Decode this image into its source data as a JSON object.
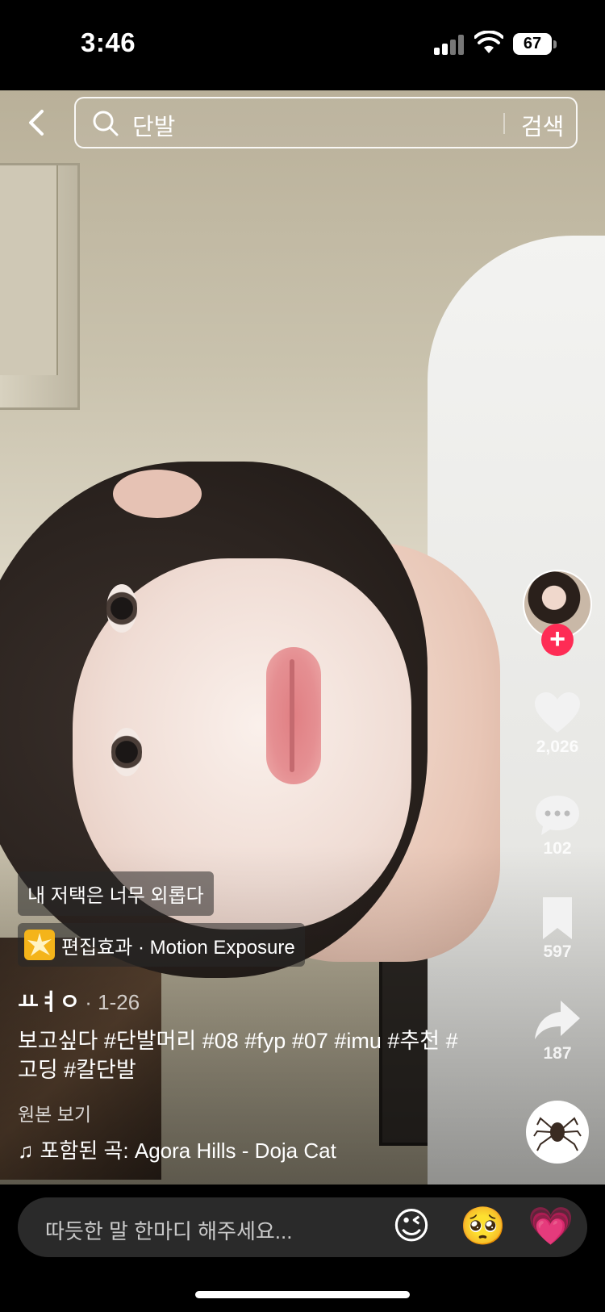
{
  "status_bar": {
    "time": "3:46",
    "battery": "67"
  },
  "search": {
    "query": "단발",
    "button_label": "검색"
  },
  "actions": {
    "likes": "2,026",
    "comments": "102",
    "saves": "597",
    "shares": "187"
  },
  "overlay": {
    "sticker_tag": "내 저택은 너무 외롭다",
    "effect_tag": "편집효과 · Motion Exposure",
    "author": "ㅛㅕㅇ",
    "date": "· 1-26",
    "description": "보고싶다 #단발머리 #08 #fyp #07 #imu #추천 #고딩 #칼단발",
    "original_link": "원본 보기",
    "song": "포함된 곡: Agora Hills - Doja Cat"
  },
  "comment_bar": {
    "placeholder": "따듯한 말 한마디 해주세요...",
    "emojis": [
      "😉",
      "🥺",
      "💗"
    ]
  },
  "colors": {
    "follow_accent": "#fe2c55"
  }
}
